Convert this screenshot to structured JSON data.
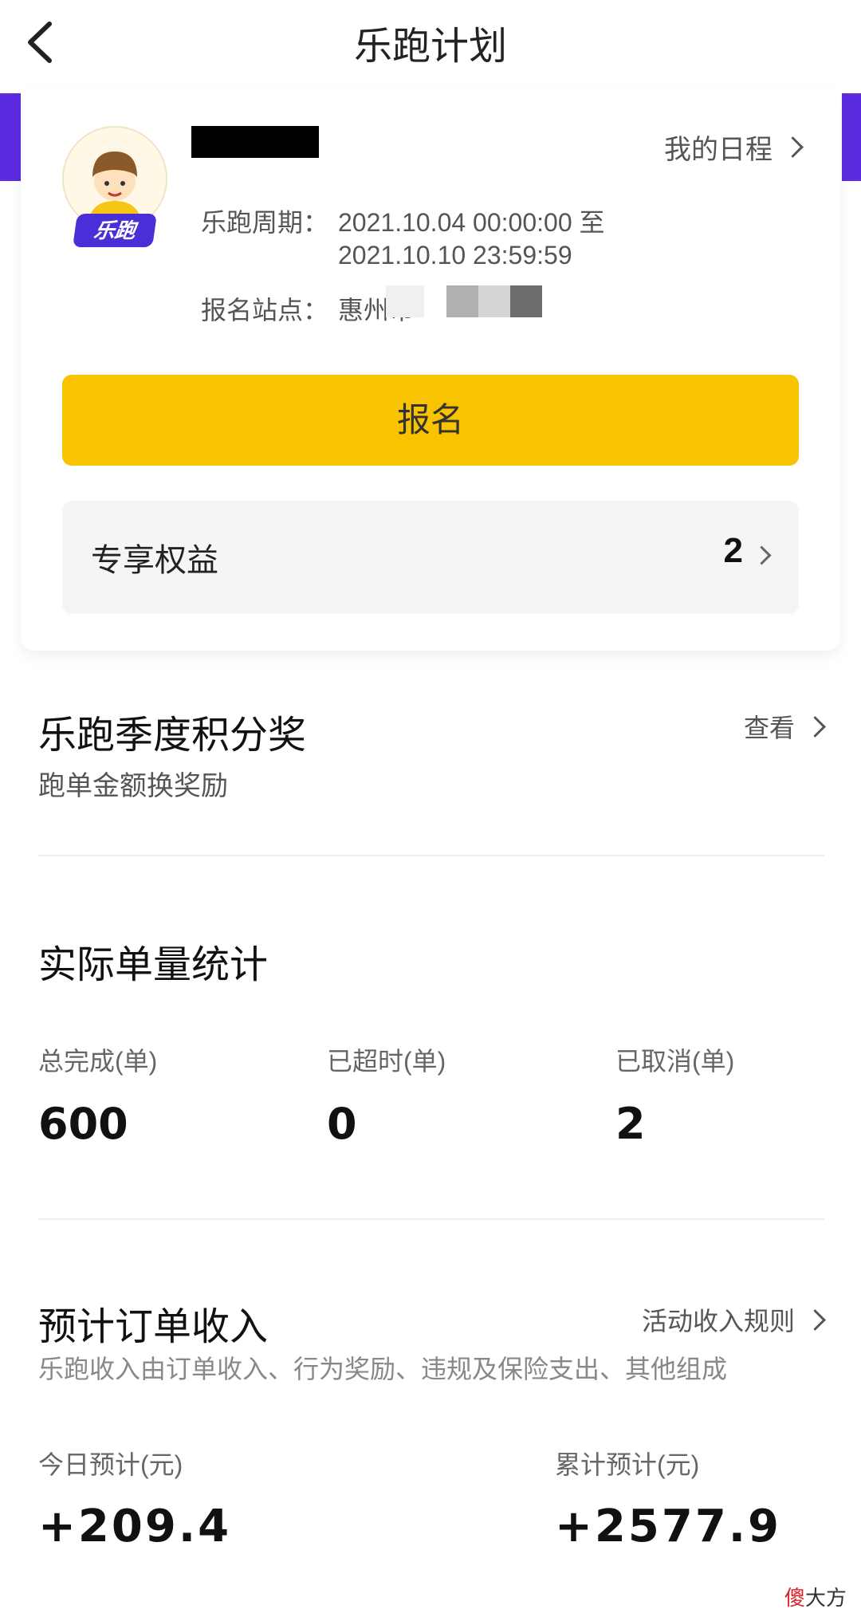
{
  "header": {
    "title": "乐跑计划",
    "back_icon": "back-arrow-icon"
  },
  "profile": {
    "avatar_badge": "乐跑",
    "schedule_link": "我的日程",
    "period_label": "乐跑周期：",
    "period_line1": "2021.10.04 00:00:00 至",
    "period_line2": "2021.10.10 23:59:59",
    "station_label": "报名站点：",
    "station_value": "惠州市"
  },
  "signup_button": "报名",
  "benefits": {
    "label": "专享权益",
    "count": "2"
  },
  "season": {
    "title": "乐跑季度积分奖",
    "subtitle": "跑单金额换奖励",
    "link": "查看"
  },
  "stats": {
    "title": "实际单量统计",
    "items": [
      {
        "label": "总完成(单)",
        "value": "600"
      },
      {
        "label": "已超时(单)",
        "value": "0"
      },
      {
        "label": "已取消(单)",
        "value": "2"
      }
    ]
  },
  "income": {
    "title": "预计订单收入",
    "link": "活动收入规则",
    "subtitle": "乐跑收入由订单收入、行为奖励、违规及保险支出、其他组成",
    "today_label": "今日预计(元)",
    "today_value": "+209.4",
    "total_label": "累计预计(元)",
    "total_value": "+2577.9"
  },
  "watermark": {
    "red": "傻",
    "rest": "大方"
  },
  "colors": {
    "accent_yellow": "#f8c300",
    "brand_purple": "#5b2be0"
  }
}
